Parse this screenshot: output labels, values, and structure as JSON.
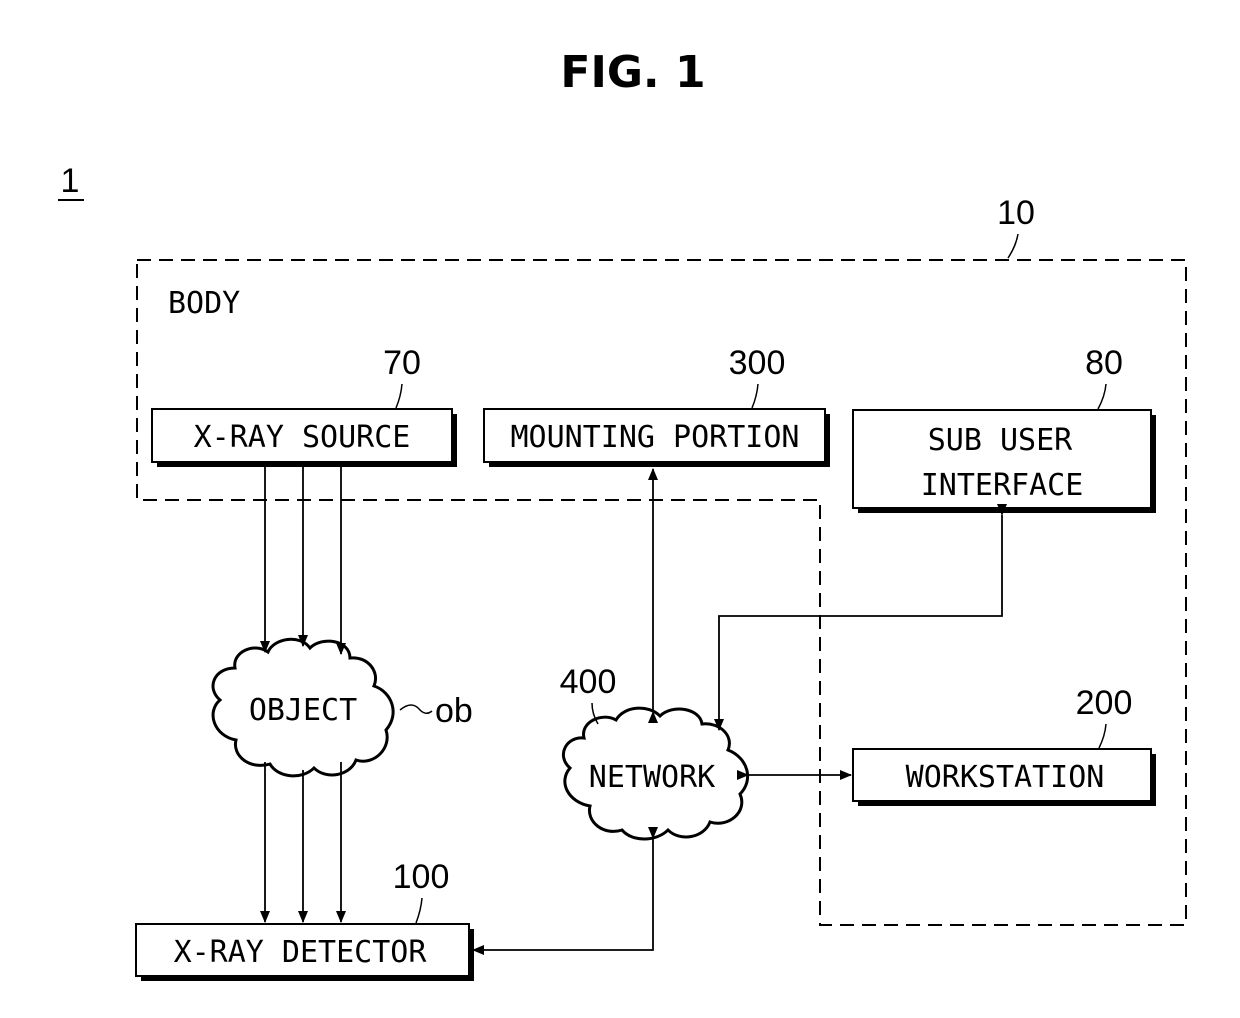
{
  "figure": {
    "title": "FIG. 1",
    "system_ref": "1"
  },
  "body_region": {
    "label": "BODY",
    "ref": "10"
  },
  "blocks": {
    "xray_source": {
      "label": "X-RAY SOURCE",
      "ref": "70"
    },
    "mounting_portion": {
      "label": "MOUNTING PORTION",
      "ref": "300"
    },
    "sub_user_interface": {
      "label_line1": "SUB USER",
      "label_line2": "INTERFACE",
      "ref": "80"
    },
    "workstation": {
      "label": "WORKSTATION",
      "ref": "200"
    },
    "xray_detector": {
      "label": "X-RAY DETECTOR",
      "ref": "100"
    }
  },
  "clouds": {
    "object": {
      "label": "OBJECT",
      "ref": "ob"
    },
    "network": {
      "label": "NETWORK",
      "ref": "400"
    }
  },
  "connections": [
    {
      "from": "X-RAY SOURCE",
      "to": "OBJECT",
      "type": "x-ray beams (3)"
    },
    {
      "from": "OBJECT",
      "to": "X-RAY DETECTOR",
      "type": "x-ray beams (3)"
    },
    {
      "from": "MOUNTING PORTION",
      "to": "NETWORK",
      "type": "bidirectional"
    },
    {
      "from": "SUB USER INTERFACE",
      "to": "NETWORK",
      "type": "bidirectional"
    },
    {
      "from": "NETWORK",
      "to": "WORKSTATION",
      "type": "bidirectional"
    },
    {
      "from": "NETWORK",
      "to": "X-RAY DETECTOR",
      "type": "bidirectional"
    }
  ]
}
